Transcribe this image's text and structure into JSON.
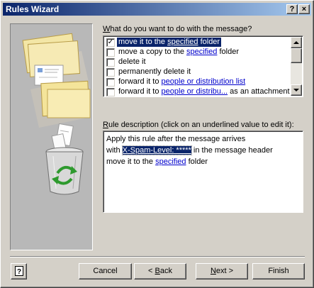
{
  "window": {
    "title": "Rules Wizard",
    "help_glyph": "?",
    "close_glyph": "×"
  },
  "actions": {
    "question_prefix": "W",
    "question_rest": "hat do you want to do with the message?",
    "items": [
      {
        "checked": true,
        "selected": true,
        "parts": [
          "move it to the ",
          "specified",
          " folder"
        ],
        "link_index": 1
      },
      {
        "checked": false,
        "selected": false,
        "parts": [
          "move a copy to the ",
          "specified",
          " folder"
        ],
        "link_index": 1
      },
      {
        "checked": false,
        "selected": false,
        "parts": [
          "delete it"
        ],
        "link_index": -1
      },
      {
        "checked": false,
        "selected": false,
        "parts": [
          "permanently delete it"
        ],
        "link_index": -1
      },
      {
        "checked": false,
        "selected": false,
        "parts": [
          "forward it to ",
          "people or distribution list"
        ],
        "link_index": 1
      },
      {
        "checked": false,
        "selected": false,
        "parts": [
          "forward it to ",
          "people or distribu...",
          " as an attachment"
        ],
        "link_index": 1
      }
    ]
  },
  "description": {
    "label_prefix": "R",
    "label_rest": "ule description (click on an underlined value to edit it):",
    "line1": "Apply this rule after the message arrives",
    "line2_pre": "with ",
    "line2_value": "X-Spam-Level: *****",
    "line2_post": " in the message header",
    "line3_pre": "move it to the ",
    "line3_link": "specified",
    "line3_post": " folder"
  },
  "buttons": {
    "cancel": "Cancel",
    "back_prefix": "< ",
    "back_mnemonic": "B",
    "back_rest": "ack",
    "next_mnemonic": "N",
    "next_rest": "ext >",
    "finish": "Finish"
  },
  "colors": {
    "title_start": "#0a246a",
    "title_end": "#a6caf0",
    "link": "#0000cc",
    "selection": "#0a246a",
    "face": "#d4d0c8"
  }
}
